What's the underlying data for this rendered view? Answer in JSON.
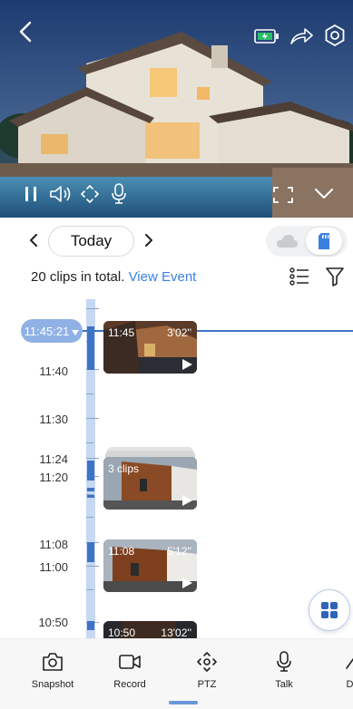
{
  "video": {
    "camera_icons": [
      "back-icon",
      "battery-icon",
      "share-icon",
      "settings-icon"
    ],
    "controls": [
      "pause-icon",
      "volume-icon",
      "ptz-icon",
      "mic-icon",
      "fullscreen-icon",
      "collapse-icon"
    ]
  },
  "date_nav": {
    "label": "Today",
    "storage_options": [
      "cloud",
      "sd-card"
    ],
    "storage_selected": "sd-card"
  },
  "summary": {
    "count_text": "20 clips in total.",
    "link_text": "View Event"
  },
  "timeline": {
    "current_time": "11:45:21",
    "time_labels": [
      "11:40",
      "11:30",
      "11:24",
      "11:20",
      "11:08",
      "11:00",
      "10:50"
    ],
    "clips": [
      {
        "time": "11:45",
        "duration": "3'02''"
      },
      {
        "time": "3 clips",
        "duration": ""
      },
      {
        "time": "11:08",
        "duration": "5'12''"
      },
      {
        "time": "10:50",
        "duration": "13'02''"
      }
    ]
  },
  "toolbar": {
    "items": [
      {
        "label": "Snapshot",
        "icon": "camera-icon"
      },
      {
        "label": "Record",
        "icon": "video-icon"
      },
      {
        "label": "PTZ",
        "icon": "ptz-icon"
      },
      {
        "label": "Talk",
        "icon": "mic-icon"
      },
      {
        "label": "Det",
        "icon": "detect-icon"
      }
    ]
  },
  "colors": {
    "accent": "#3b7fe0",
    "timeline_track": "#c7d8f3",
    "timeline_segment": "#3f73c6",
    "current_pill": "#8fb1e6"
  }
}
